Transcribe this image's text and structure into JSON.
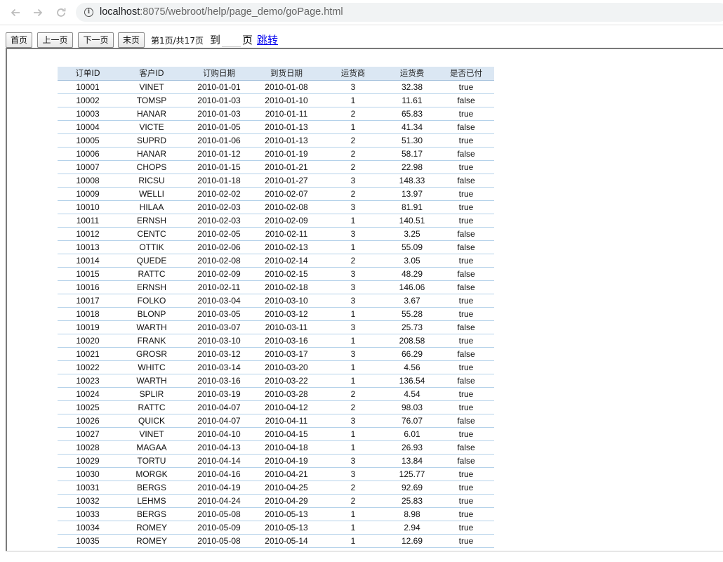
{
  "browser": {
    "url_host": "localhost",
    "url_rest": ":8075/webroot/help/page_demo/goPage.html",
    "icons": {
      "back": "arrow-left-icon",
      "forward": "arrow-right-icon",
      "reload": "reload-icon",
      "info": "info-icon"
    }
  },
  "toolbar": {
    "first_label": "首页",
    "prev_label": "上一页",
    "next_label": "下一页",
    "last_label": "末页",
    "page_info": "第1页/共17页",
    "to_label": "到",
    "page_input_value": "",
    "page_label": "页",
    "jump_label": "跳转"
  },
  "table": {
    "columns": [
      "订单ID",
      "客户ID",
      "订购日期",
      "到货日期",
      "运货商",
      "运货费",
      "是否已付"
    ],
    "rows": [
      [
        "10001",
        "VINET",
        "2010-01-01",
        "2010-01-08",
        "3",
        "32.38",
        "true"
      ],
      [
        "10002",
        "TOMSP",
        "2010-01-03",
        "2010-01-10",
        "1",
        "11.61",
        "false"
      ],
      [
        "10003",
        "HANAR",
        "2010-01-03",
        "2010-01-11",
        "2",
        "65.83",
        "true"
      ],
      [
        "10004",
        "VICTE",
        "2010-01-05",
        "2010-01-13",
        "1",
        "41.34",
        "false"
      ],
      [
        "10005",
        "SUPRD",
        "2010-01-06",
        "2010-01-13",
        "2",
        "51.30",
        "true"
      ],
      [
        "10006",
        "HANAR",
        "2010-01-12",
        "2010-01-19",
        "2",
        "58.17",
        "false"
      ],
      [
        "10007",
        "CHOPS",
        "2010-01-15",
        "2010-01-21",
        "2",
        "22.98",
        "true"
      ],
      [
        "10008",
        "RICSU",
        "2010-01-18",
        "2010-01-27",
        "3",
        "148.33",
        "false"
      ],
      [
        "10009",
        "WELLI",
        "2010-02-02",
        "2010-02-07",
        "2",
        "13.97",
        "true"
      ],
      [
        "10010",
        "HILAA",
        "2010-02-03",
        "2010-02-08",
        "3",
        "81.91",
        "true"
      ],
      [
        "10011",
        "ERNSH",
        "2010-02-03",
        "2010-02-09",
        "1",
        "140.51",
        "true"
      ],
      [
        "10012",
        "CENTC",
        "2010-02-05",
        "2010-02-11",
        "3",
        "3.25",
        "false"
      ],
      [
        "10013",
        "OTTIK",
        "2010-02-06",
        "2010-02-13",
        "1",
        "55.09",
        "false"
      ],
      [
        "10014",
        "QUEDE",
        "2010-02-08",
        "2010-02-14",
        "2",
        "3.05",
        "true"
      ],
      [
        "10015",
        "RATTC",
        "2010-02-09",
        "2010-02-15",
        "3",
        "48.29",
        "false"
      ],
      [
        "10016",
        "ERNSH",
        "2010-02-11",
        "2010-02-18",
        "3",
        "146.06",
        "false"
      ],
      [
        "10017",
        "FOLKO",
        "2010-03-04",
        "2010-03-10",
        "3",
        "3.67",
        "true"
      ],
      [
        "10018",
        "BLONP",
        "2010-03-05",
        "2010-03-12",
        "1",
        "55.28",
        "true"
      ],
      [
        "10019",
        "WARTH",
        "2010-03-07",
        "2010-03-11",
        "3",
        "25.73",
        "false"
      ],
      [
        "10020",
        "FRANK",
        "2010-03-10",
        "2010-03-16",
        "1",
        "208.58",
        "true"
      ],
      [
        "10021",
        "GROSR",
        "2010-03-12",
        "2010-03-17",
        "3",
        "66.29",
        "false"
      ],
      [
        "10022",
        "WHITC",
        "2010-03-14",
        "2010-03-20",
        "1",
        "4.56",
        "true"
      ],
      [
        "10023",
        "WARTH",
        "2010-03-16",
        "2010-03-22",
        "1",
        "136.54",
        "false"
      ],
      [
        "10024",
        "SPLIR",
        "2010-03-19",
        "2010-03-28",
        "2",
        "4.54",
        "true"
      ],
      [
        "10025",
        "RATTC",
        "2010-04-07",
        "2010-04-12",
        "2",
        "98.03",
        "true"
      ],
      [
        "10026",
        "QUICK",
        "2010-04-07",
        "2010-04-11",
        "3",
        "76.07",
        "false"
      ],
      [
        "10027",
        "VINET",
        "2010-04-10",
        "2010-04-15",
        "1",
        "6.01",
        "true"
      ],
      [
        "10028",
        "MAGAA",
        "2010-04-13",
        "2010-04-18",
        "1",
        "26.93",
        "false"
      ],
      [
        "10029",
        "TORTU",
        "2010-04-14",
        "2010-04-19",
        "3",
        "13.84",
        "false"
      ],
      [
        "10030",
        "MORGK",
        "2010-04-16",
        "2010-04-21",
        "3",
        "125.77",
        "true"
      ],
      [
        "10031",
        "BERGS",
        "2010-04-19",
        "2010-04-25",
        "2",
        "92.69",
        "true"
      ],
      [
        "10032",
        "LEHMS",
        "2010-04-24",
        "2010-04-29",
        "2",
        "25.83",
        "true"
      ],
      [
        "10033",
        "BERGS",
        "2010-05-08",
        "2010-05-13",
        "1",
        "8.98",
        "true"
      ],
      [
        "10034",
        "ROMEY",
        "2010-05-09",
        "2010-05-13",
        "1",
        "2.94",
        "true"
      ],
      [
        "10035",
        "ROMEY",
        "2010-05-08",
        "2010-05-14",
        "1",
        "12.69",
        "true"
      ]
    ]
  }
}
